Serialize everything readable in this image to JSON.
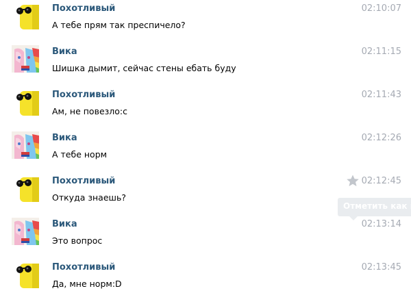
{
  "colors": {
    "author": "#2b587a",
    "text": "#000000",
    "time": "#a5aab3",
    "tooltip_bg": "#e9ecef",
    "star": "#c2c6cc"
  },
  "messages": [
    {
      "author": "Похотливый",
      "text": "А тебе прям так преспичело?",
      "time": "02:10:07",
      "avatar": "yellow-sunglasses-avatar"
    },
    {
      "author": "Вика",
      "text": "Шишка дымит, сейчас стены ебать буду",
      "time": "02:11:15",
      "avatar": "pony-avatar"
    },
    {
      "author": "Похотливый",
      "text": "Ам, не повезло:с",
      "time": "02:11:43",
      "avatar": "yellow-sunglasses-avatar"
    },
    {
      "author": "Вика",
      "text": "А тебе норм",
      "time": "02:12:26",
      "avatar": "pony-avatar"
    },
    {
      "author": "Похотливый",
      "text": "Откуда знаешь?",
      "time": "02:12:45",
      "avatar": "yellow-sunglasses-avatar"
    },
    {
      "author": "Вика",
      "text": "Это вопрос",
      "time": "02:13:14",
      "avatar": "pony-avatar"
    },
    {
      "author": "Похотливый",
      "text": "Да, мне норм:D",
      "time": "02:13:45",
      "avatar": "yellow-sunglasses-avatar"
    }
  ],
  "tooltip": {
    "label": "Отметить как важное"
  }
}
